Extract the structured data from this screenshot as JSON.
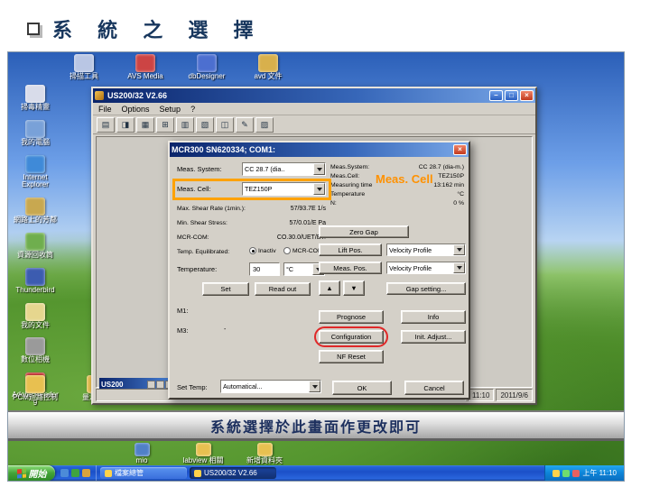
{
  "slide": {
    "title": "系 統 之 選 擇",
    "caption": "系統選擇於此畫面作更改即可"
  },
  "annotations": {
    "meas_cell": "Meas. Cell"
  },
  "desktop": {
    "icons_top": [
      {
        "label": "掃描工具",
        "color": "#b9c6e4"
      },
      {
        "label": "AVS Media",
        "color": "#cc4444"
      },
      {
        "label": "dbDesigner",
        "color": "#4c6fd0"
      },
      {
        "label": "avd 文件",
        "color": "#d8b04c"
      }
    ],
    "icons_left": [
      {
        "label": "掃毒精靈",
        "color": "#d8dcea"
      },
      {
        "label": "我的電腦",
        "color": "#79a1d8"
      },
      {
        "label": "Internet Explorer",
        "color": "#3f8ad8"
      },
      {
        "label": "網路上的芳鄰",
        "color": "#c8a850"
      },
      {
        "label": "資源回收筒",
        "color": "#6fae4e"
      },
      {
        "label": "Thunderbird",
        "color": "#3c5cb0"
      },
      {
        "label": "我的文件",
        "color": "#e6d68e"
      },
      {
        "label": "數位相機",
        "color": "#9a9a9a"
      },
      {
        "label": "Adobe Reader 9",
        "color": "#c23232"
      }
    ],
    "icons_bottom": [
      {
        "label": "PCM迴路控制",
        "color": "#e8c050"
      },
      {
        "label": "量測程式",
        "color": "#e8c050"
      }
    ],
    "icons_footer": [
      {
        "label": "mio",
        "color": "#5080c8"
      },
      {
        "label": "labview 相關",
        "color": "#e8c050"
      },
      {
        "label": "新增資料夾",
        "color": "#e8c050"
      }
    ]
  },
  "window": {
    "title": "US200/32 V2.66",
    "menu": [
      "File",
      "Options",
      "Setup",
      "?"
    ],
    "toolbar": [
      "▤",
      "◨",
      "▦",
      "⊞",
      "▥",
      "▧",
      "◫",
      "✎",
      "▨"
    ],
    "child_title": "US200",
    "status_time": "11:10",
    "status_date": "2011/9/6"
  },
  "dialog": {
    "title": "MCR300 SN620334; COM1:",
    "left": {
      "meas_system_label": "Meas. System:",
      "meas_system_value": "CC 28.7 (dia..",
      "meas_cell_label": "Meas. Cell:",
      "meas_cell_value": "TEZ150P",
      "max_shear_label": "Max. Shear Rate (1min.):",
      "max_shear_value": "57/93.7E 1/s",
      "min_shear_label": "Min. Shear Stress:",
      "min_shear_value": "57/0.01/E Pa",
      "mcr_com_label": "MCR-COM:",
      "mcr_com_value": "CO.30.0/UET/ET.",
      "temp_eq_label": "Temp. Equilibrated:",
      "radio_inactiv": "Inactiv",
      "radio_mcr_cont": "MCR-CONT",
      "temperature_label": "Temperature:",
      "temperature_value": "30",
      "temperature_unit": "°C",
      "set_button": "Set",
      "readout_button": "Read out",
      "m1_label": "M1:",
      "m3_label": "M3:",
      "m3_value": "-",
      "set_temp_label": "Set Temp:",
      "set_temp_value": "Automatical..."
    },
    "right": {
      "info": [
        {
          "label": "Meas.System:",
          "value": "CC 28.7 (dia-m.)"
        },
        {
          "label": "Meas.Cell:",
          "value": "TEZ150P"
        },
        {
          "label": "Measuring time",
          "value": "13:162 min"
        },
        {
          "label": "Temperature",
          "value": "°C"
        },
        {
          "label": "N:",
          "value": "0 %"
        }
      ],
      "zero_gap_button": "Zero Gap",
      "lift_pos_button": "Lift Pos.",
      "meas_pos_button": "Meas. Pos.",
      "velocity_profile": "Velocity Profile",
      "up_button": "▲",
      "down_button": "▼",
      "gap_setting_button": "Gap setting...",
      "prognose_button": "Prognose",
      "info_button": "Info",
      "configuration_button": "Configuration",
      "init_adjust_button": "Init. Adjust...",
      "nf_reset_button": "NF Reset",
      "ok_button": "OK",
      "cancel_button": "Cancel"
    }
  },
  "taskbar": {
    "start": "開始",
    "tasks": [
      {
        "label": "檔案總管"
      },
      {
        "label": "US200/32 V2.66",
        "active": true
      }
    ],
    "tray_time": "上午 11:10"
  }
}
